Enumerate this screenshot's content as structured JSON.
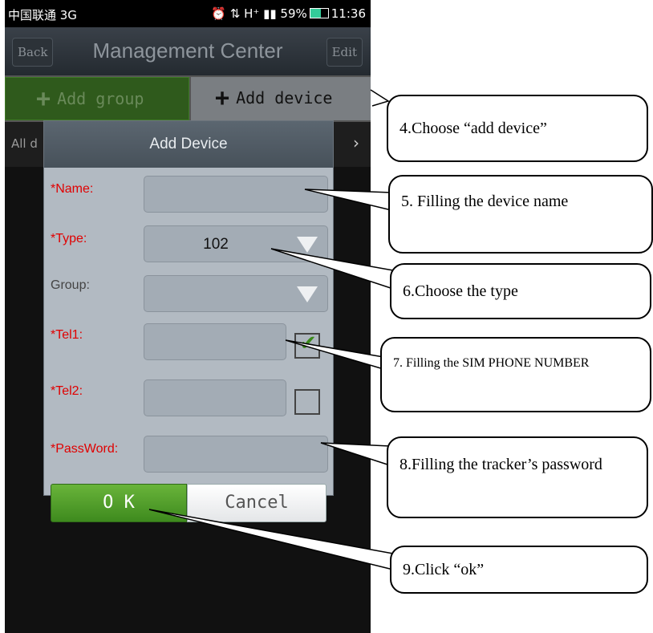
{
  "status_bar": {
    "carrier": "中国联通 3G",
    "right_icons": "⏰ ⇅ H⁺ ▮▮",
    "battery": "59%",
    "time": "11:36"
  },
  "titlebar": {
    "back_label": "Back",
    "title": "Management Center",
    "edit_label": "Edit"
  },
  "tabs": {
    "add_group": "Add group",
    "add_device": "Add device"
  },
  "list_header": {
    "all_text": "All d"
  },
  "dialog": {
    "title": "Add Device",
    "name_label": "*Name:",
    "type_label": "*Type:",
    "type_value": "102",
    "group_label": "Group:",
    "tel1_label": "*Tel1:",
    "tel2_label": "*Tel2:",
    "password_label": "*PassWord:",
    "tel1_checked": true,
    "tel2_checked": false,
    "ok_label": "O K",
    "cancel_label": "Cancel"
  },
  "callouts": {
    "c4": "4.Choose “add device”",
    "c5": "5.  Filling  the  device name",
    "c6": "6.Choose the type",
    "c7": "7.  Filling  the  SIM  PHONE NUMBER",
    "c8": "8.Filling the tracker’s password",
    "c9": "9.Click “ok”"
  },
  "colors": {
    "required_label": "#e00000",
    "ok_green": "#4f9a28",
    "tab_active_bg": "#7a7e82"
  }
}
